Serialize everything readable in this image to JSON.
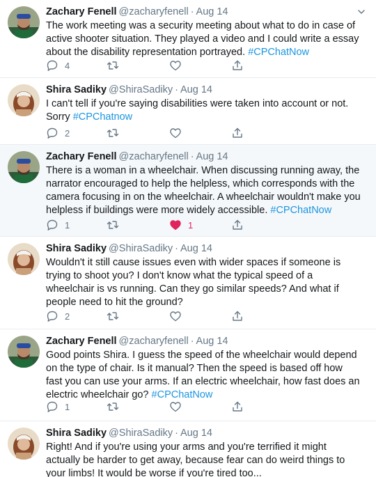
{
  "tweets": [
    {
      "author": "zachary",
      "name": "Zachary Fenell",
      "handle": "@zacharyfenell",
      "date": "Aug 14",
      "text": "The work meeting was a security meeting about what to do in case of active shooter situation. They played a video and I could write a essay about the disability representation portrayed.",
      "hashtag": "#CPChatNow",
      "replies": "4",
      "retweets": "",
      "likes": "",
      "liked": false
    },
    {
      "author": "shira",
      "name": "Shira Sadiky",
      "handle": "@ShiraSadiky",
      "date": "Aug 14",
      "text": "I can't tell if you're saying disabilities were taken into account or not. Sorry",
      "hashtag": "#CPChatnow",
      "replies": "2",
      "retweets": "",
      "likes": "",
      "liked": false
    },
    {
      "author": "zachary",
      "name": "Zachary Fenell",
      "handle": "@zacharyfenell",
      "date": "Aug 14",
      "text": "There is a woman in a wheelchair. When discussing running away, the narrator encouraged to help the helpless, which corresponds with the camera focusing in on the wheelchair. A wheelchair wouldn't make you helpless if buildings were more widely accessible.",
      "hashtag": "#CPChatNow",
      "replies": "1",
      "retweets": "",
      "likes": "1",
      "liked": true
    },
    {
      "author": "shira",
      "name": "Shira Sadiky",
      "handle": "@ShiraSadiky",
      "date": "Aug 14",
      "text": "Wouldn't it still cause issues even with wider spaces if someone is trying to shoot you? I don't know what the typical speed of a wheelchair is vs running. Can they go similar speeds? And what if people need to hit the ground?",
      "hashtag": "",
      "replies": "2",
      "retweets": "",
      "likes": "",
      "liked": false
    },
    {
      "author": "zachary",
      "name": "Zachary Fenell",
      "handle": "@zacharyfenell",
      "date": "Aug 14",
      "text": "Good points Shira. I guess the speed of the wheelchair would depend on the type of chair. Is it manual? Then the speed is based off how fast you can use your arms. If an electric wheelchair, how fast does an electric wheelchair go?",
      "hashtag": "#CPChatNow",
      "replies": "1",
      "retweets": "",
      "likes": "",
      "liked": false
    },
    {
      "author": "shira",
      "name": "Shira Sadiky",
      "handle": "@ShiraSadiky",
      "date": "Aug 14",
      "text": "Right! And if you're using your arms and you're terrified it might actually be harder to get away, because fear can do weird things to your limbs! It would be worse if you're tired too...",
      "hashtag": "",
      "replies": "",
      "retweets": "",
      "likes": "",
      "liked": false
    }
  ],
  "colors": {
    "text": "#14171a",
    "secondary": "#657786",
    "link": "#1b95e0",
    "like": "#e0245e",
    "divider": "#e6ecf0",
    "highlight_bg": "#f5f8fa"
  },
  "icons": {
    "reply": "reply-icon",
    "retweet": "retweet-icon",
    "like": "heart-icon",
    "share": "share-icon",
    "menu": "chevron-down-icon"
  }
}
